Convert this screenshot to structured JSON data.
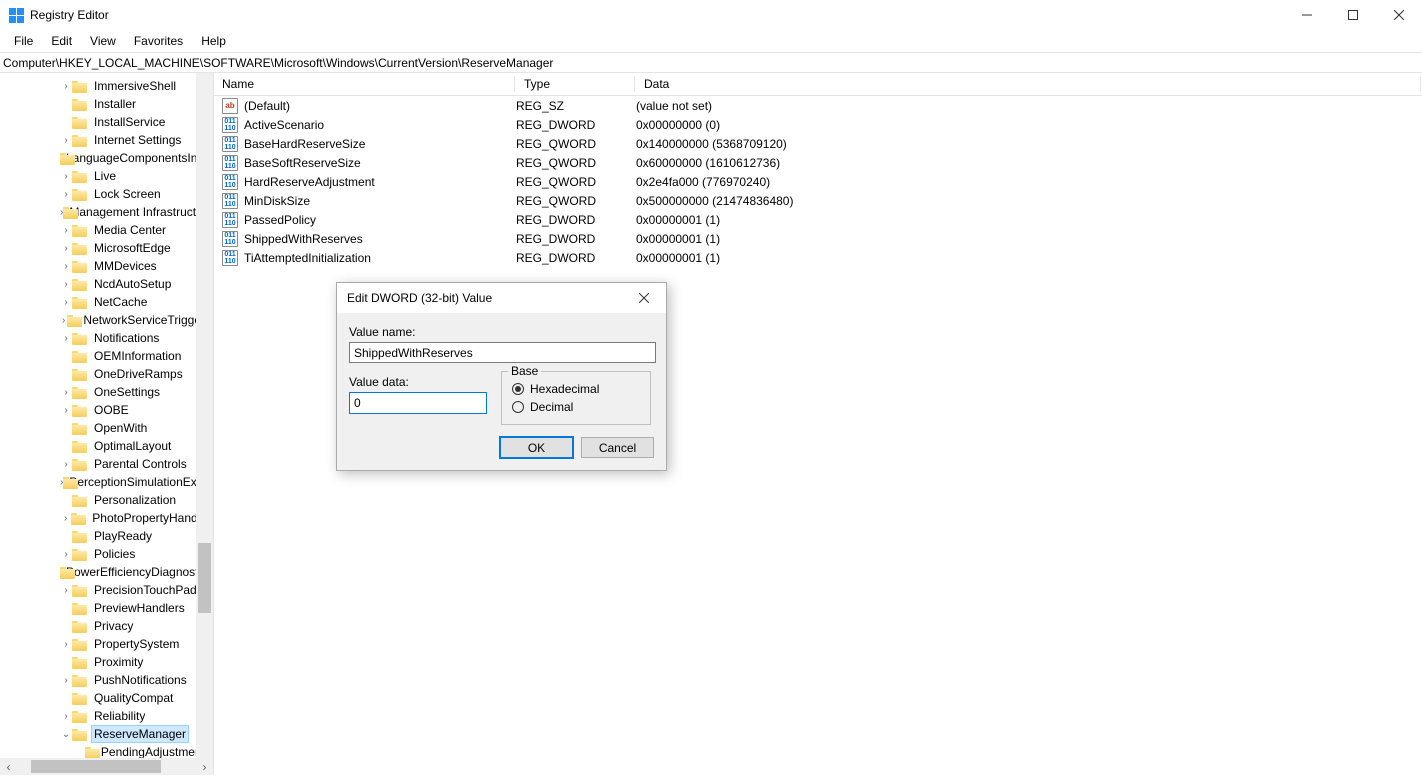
{
  "window": {
    "title": "Registry Editor"
  },
  "menu": {
    "items": [
      "File",
      "Edit",
      "View",
      "Favorites",
      "Help"
    ]
  },
  "address": {
    "path": "Computer\\HKEY_LOCAL_MACHINE\\SOFTWARE\\Microsoft\\Windows\\CurrentVersion\\ReserveManager"
  },
  "tree": {
    "items": [
      {
        "label": "ImmersiveShell",
        "indent": 72,
        "exp": ">"
      },
      {
        "label": "Installer",
        "indent": 72,
        "exp": ""
      },
      {
        "label": "InstallService",
        "indent": 72,
        "exp": ""
      },
      {
        "label": "Internet Settings",
        "indent": 72,
        "exp": ">"
      },
      {
        "label": "LanguageComponentsInstaller",
        "indent": 72,
        "exp": ""
      },
      {
        "label": "Live",
        "indent": 72,
        "exp": ">"
      },
      {
        "label": "Lock Screen",
        "indent": 72,
        "exp": ">"
      },
      {
        "label": "Management Infrastructure",
        "indent": 72,
        "exp": ">"
      },
      {
        "label": "Media Center",
        "indent": 72,
        "exp": ">"
      },
      {
        "label": "MicrosoftEdge",
        "indent": 72,
        "exp": ">"
      },
      {
        "label": "MMDevices",
        "indent": 72,
        "exp": ">"
      },
      {
        "label": "NcdAutoSetup",
        "indent": 72,
        "exp": ">"
      },
      {
        "label": "NetCache",
        "indent": 72,
        "exp": ">"
      },
      {
        "label": "NetworkServiceTriggers",
        "indent": 72,
        "exp": ">"
      },
      {
        "label": "Notifications",
        "indent": 72,
        "exp": ">"
      },
      {
        "label": "OEMInformation",
        "indent": 72,
        "exp": ""
      },
      {
        "label": "OneDriveRamps",
        "indent": 72,
        "exp": ""
      },
      {
        "label": "OneSettings",
        "indent": 72,
        "exp": ">"
      },
      {
        "label": "OOBE",
        "indent": 72,
        "exp": ">"
      },
      {
        "label": "OpenWith",
        "indent": 72,
        "exp": ""
      },
      {
        "label": "OptimalLayout",
        "indent": 72,
        "exp": ""
      },
      {
        "label": "Parental Controls",
        "indent": 72,
        "exp": ">"
      },
      {
        "label": "PerceptionSimulationExtensions",
        "indent": 72,
        "exp": ">"
      },
      {
        "label": "Personalization",
        "indent": 72,
        "exp": ""
      },
      {
        "label": "PhotoPropertyHandler",
        "indent": 72,
        "exp": ">"
      },
      {
        "label": "PlayReady",
        "indent": 72,
        "exp": ""
      },
      {
        "label": "Policies",
        "indent": 72,
        "exp": ">"
      },
      {
        "label": "PowerEfficiencyDiagnostics",
        "indent": 72,
        "exp": ""
      },
      {
        "label": "PrecisionTouchPad",
        "indent": 72,
        "exp": ">"
      },
      {
        "label": "PreviewHandlers",
        "indent": 72,
        "exp": ""
      },
      {
        "label": "Privacy",
        "indent": 72,
        "exp": ""
      },
      {
        "label": "PropertySystem",
        "indent": 72,
        "exp": ">"
      },
      {
        "label": "Proximity",
        "indent": 72,
        "exp": ""
      },
      {
        "label": "PushNotifications",
        "indent": 72,
        "exp": ">"
      },
      {
        "label": "QualityCompat",
        "indent": 72,
        "exp": ""
      },
      {
        "label": "Reliability",
        "indent": 72,
        "exp": ">"
      },
      {
        "label": "ReserveManager",
        "indent": 72,
        "exp": "v",
        "selected": true
      },
      {
        "label": "PendingAdjustments",
        "indent": 90,
        "exp": ""
      }
    ]
  },
  "list": {
    "headers": {
      "name": "Name",
      "type": "Type",
      "data": "Data"
    },
    "rows": [
      {
        "icon": "sz",
        "name": "(Default)",
        "type": "REG_SZ",
        "data": "(value not set)"
      },
      {
        "icon": "bin",
        "name": "ActiveScenario",
        "type": "REG_DWORD",
        "data": "0x00000000 (0)"
      },
      {
        "icon": "bin",
        "name": "BaseHardReserveSize",
        "type": "REG_QWORD",
        "data": "0x140000000 (5368709120)"
      },
      {
        "icon": "bin",
        "name": "BaseSoftReserveSize",
        "type": "REG_QWORD",
        "data": "0x60000000 (1610612736)"
      },
      {
        "icon": "bin",
        "name": "HardReserveAdjustment",
        "type": "REG_QWORD",
        "data": "0x2e4fa000 (776970240)"
      },
      {
        "icon": "bin",
        "name": "MinDiskSize",
        "type": "REG_QWORD",
        "data": "0x500000000 (21474836480)"
      },
      {
        "icon": "bin",
        "name": "PassedPolicy",
        "type": "REG_DWORD",
        "data": "0x00000001 (1)"
      },
      {
        "icon": "bin",
        "name": "ShippedWithReserves",
        "type": "REG_DWORD",
        "data": "0x00000001 (1)"
      },
      {
        "icon": "bin",
        "name": "TiAttemptedInitialization",
        "type": "REG_DWORD",
        "data": "0x00000001 (1)"
      }
    ]
  },
  "dialog": {
    "title": "Edit DWORD (32-bit) Value",
    "value_name_label": "Value name:",
    "value_name": "ShippedWithReserves",
    "value_data_label": "Value data:",
    "value_data": "0",
    "base_label": "Base",
    "hex_label": "Hexadecimal",
    "dec_label": "Decimal",
    "ok": "OK",
    "cancel": "Cancel"
  }
}
